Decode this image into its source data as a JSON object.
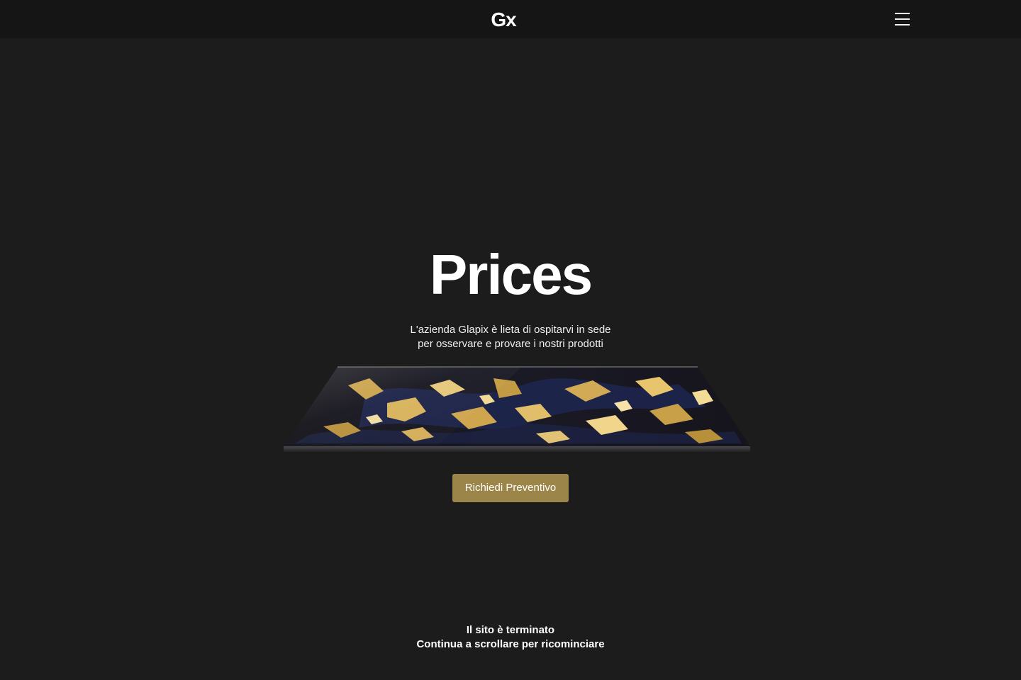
{
  "header": {
    "logo": "Gx",
    "menu_icon": "hamburger-menu-icon"
  },
  "hero": {
    "title": "Prices",
    "subtitle_line1": "L'azienda Glapix è lieta di ospitarvi in sede",
    "subtitle_line2": "per osservare e provare i nostri prodotti",
    "slab_image": "marble-slab-black-gold",
    "cta_label": "Richiedi Preventivo"
  },
  "footer": {
    "line1": "Il sito è terminato",
    "line2": "Continua a scrollare per ricominciare"
  },
  "colors": {
    "background": "#1c1c1c",
    "header_background": "#151515",
    "accent": "#9c8549",
    "text": "#ffffff"
  }
}
